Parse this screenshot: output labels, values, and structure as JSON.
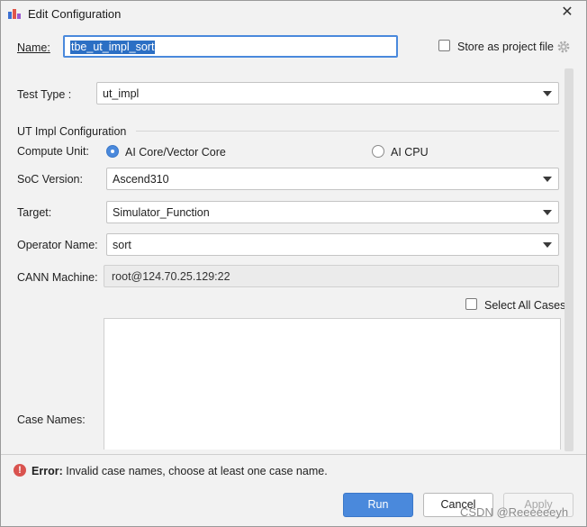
{
  "window": {
    "title": "Edit Configuration",
    "close_glyph": "✕"
  },
  "name": {
    "label": "Name:",
    "value": "tbe_ut_impl_sort"
  },
  "store_project": {
    "label": "Store as project file",
    "checked": false
  },
  "test_type": {
    "label": "Test Type :",
    "value": "ut_impl"
  },
  "ut_section": {
    "title": "UT Impl Configuration"
  },
  "compute_unit": {
    "label": "Compute Unit:",
    "options": [
      {
        "label": "AI Core/Vector Core",
        "selected": true
      },
      {
        "label": "AI CPU",
        "selected": false
      }
    ]
  },
  "soc_version": {
    "label": "SoC Version:",
    "value": "Ascend310"
  },
  "target": {
    "label": "Target:",
    "value": "Simulator_Function"
  },
  "operator_name": {
    "label": "Operator Name:",
    "value": "sort"
  },
  "cann_machine": {
    "label": "CANN Machine:",
    "value": "root@124.70.25.129:22"
  },
  "select_all": {
    "label": "Select All Cases",
    "checked": false
  },
  "case_names": {
    "label": "Case Names:"
  },
  "error": {
    "prefix": "Error:",
    "message": "Invalid case names, choose at least one case name."
  },
  "buttons": {
    "run": "Run",
    "cancel": "Cancel",
    "apply": "Apply"
  },
  "watermark": "CSDN @Reeeeeeyh",
  "colors": {
    "accent": "#4a89dc",
    "error": "#d9534f"
  }
}
